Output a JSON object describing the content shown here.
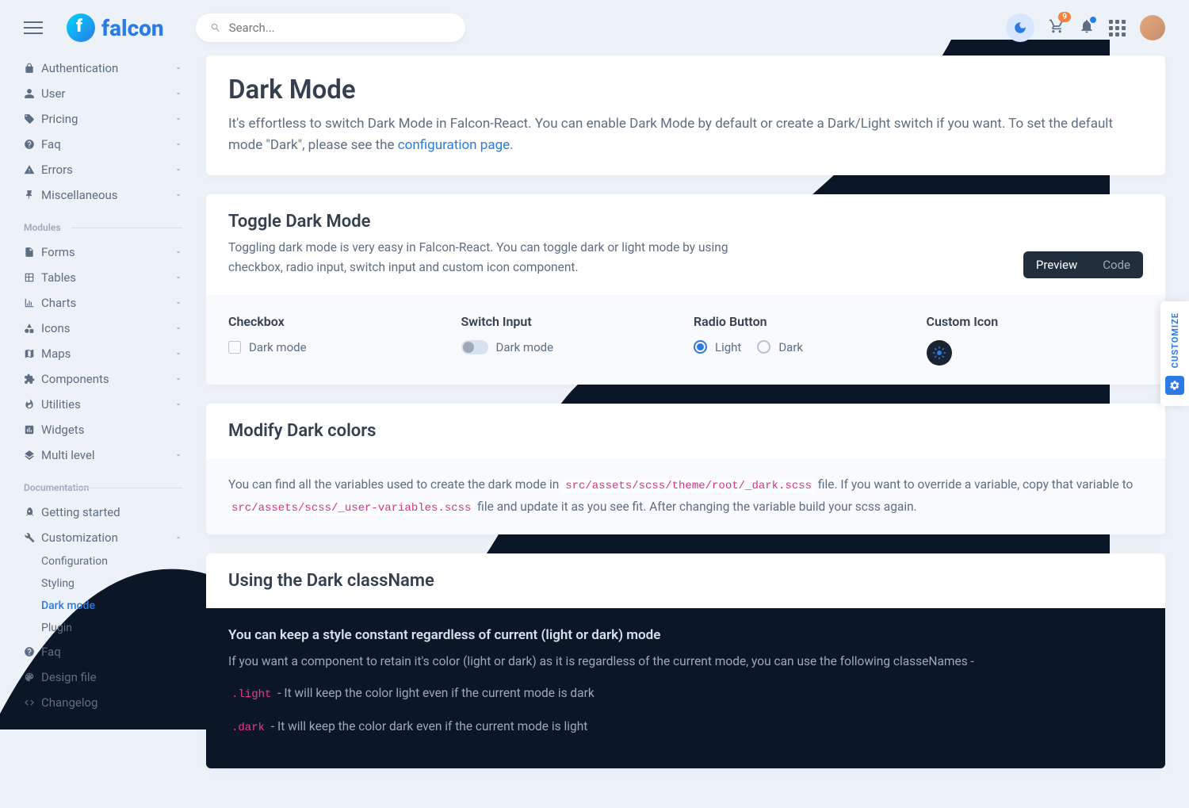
{
  "brand": "falcon",
  "search": {
    "placeholder": "Search..."
  },
  "cart_badge": "9",
  "sidebar": {
    "pages": [
      {
        "label": "Authentication",
        "icon": "lock"
      },
      {
        "label": "User",
        "icon": "user"
      },
      {
        "label": "Pricing",
        "icon": "tags"
      },
      {
        "label": "Faq",
        "icon": "question"
      },
      {
        "label": "Errors",
        "icon": "warning"
      },
      {
        "label": "Miscellaneous",
        "icon": "pin"
      }
    ],
    "section_modules": "Modules",
    "modules": [
      {
        "label": "Forms",
        "icon": "file"
      },
      {
        "label": "Tables",
        "icon": "table"
      },
      {
        "label": "Charts",
        "icon": "chart"
      },
      {
        "label": "Icons",
        "icon": "shapes"
      },
      {
        "label": "Maps",
        "icon": "map"
      },
      {
        "label": "Components",
        "icon": "puzzle"
      },
      {
        "label": "Utilities",
        "icon": "fire"
      },
      {
        "label": "Widgets",
        "icon": "poll"
      },
      {
        "label": "Multi level",
        "icon": "layers"
      }
    ],
    "section_docs": "Documentation",
    "docs": [
      {
        "label": "Getting started",
        "icon": "rocket"
      },
      {
        "label": "Customization",
        "icon": "wrench",
        "expanded": true,
        "children": [
          {
            "label": "Configuration"
          },
          {
            "label": "Styling"
          },
          {
            "label": "Dark mode",
            "active": true
          },
          {
            "label": "Plugin"
          }
        ]
      },
      {
        "label": "Faq",
        "icon": "question"
      },
      {
        "label": "Design file",
        "icon": "palette"
      },
      {
        "label": "Changelog",
        "icon": "code"
      }
    ]
  },
  "main": {
    "title": "Dark Mode",
    "lead_pre": "It's effortless to switch Dark Mode in Falcon-React. You can enable Dark Mode by default or create a Dark/Light switch if you want. To set the default mode \"Dark\", please see the ",
    "lead_link": "configuration page",
    "lead_post": ".",
    "toggle": {
      "title": "Toggle Dark Mode",
      "desc": "Toggling dark mode is very easy in Falcon-React. You can toggle dark or light mode by using checkbox, radio input, switch input and custom icon component.",
      "tabs": {
        "preview": "Preview",
        "code": "Code"
      },
      "cols": {
        "checkbox": {
          "title": "Checkbox",
          "label": "Dark mode"
        },
        "switch": {
          "title": "Switch Input",
          "label": "Dark mode"
        },
        "radio": {
          "title": "Radio Button",
          "light": "Light",
          "dark": "Dark"
        },
        "custom": {
          "title": "Custom Icon"
        }
      }
    },
    "modify": {
      "title": "Modify Dark colors",
      "pre1": "You can find all the variables used to create the dark mode in ",
      "code1": "src/assets/scss/theme/root/_dark.scss",
      "mid1": " file. If you want to override a variable, copy that variable to ",
      "code2": "src/assets/scss/_user-variables.scss",
      "post1": " file and update it as you see fit. After changing the variable build your scss again."
    },
    "using": {
      "title": "Using the Dark className",
      "h5": "You can keep a style constant regardless of current (light or dark) mode",
      "p1": "If you want a component to retain it's color (light or dark) as it is regardless of the current mode, you can use the following classeNames -",
      "light_code": ".light",
      "light_text": " - It will keep the color light even if the current mode is dark",
      "dark_code": ".dark",
      "dark_text": " - It will keep the color dark even if the current mode is light"
    }
  },
  "customize": "CUSTOMIZE"
}
